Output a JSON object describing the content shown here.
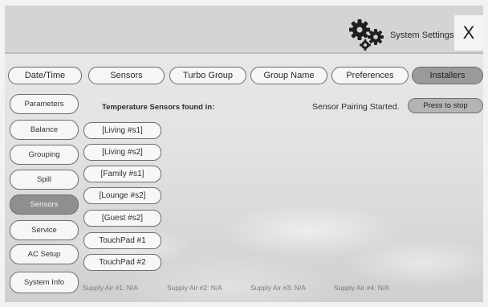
{
  "header": {
    "title": "System Settings",
    "close_label": "X",
    "gear_icon": "gears-icon"
  },
  "tabs": [
    {
      "label": "Date/Time",
      "active": false
    },
    {
      "label": "Sensors",
      "active": false
    },
    {
      "label": "Turbo Group",
      "active": false
    },
    {
      "label": "Group Name",
      "active": false
    },
    {
      "label": "Preferences",
      "active": false
    },
    {
      "label": "Installers",
      "active": true
    }
  ],
  "sidebar": {
    "items": [
      {
        "label": "Parameters",
        "active": false
      },
      {
        "label": "Balance",
        "active": false
      },
      {
        "label": "Grouping",
        "active": false
      },
      {
        "label": "Spill",
        "active": false
      },
      {
        "label": "Sensors",
        "active": true
      },
      {
        "label": "Service",
        "active": false
      },
      {
        "label": "AC Setup",
        "active": false
      },
      {
        "label": "System Info",
        "active": false
      }
    ]
  },
  "main": {
    "heading": "Temperature Sensors found in:",
    "pairing_status": "Sensor Pairing Started.",
    "stop_button": "Press to stop",
    "sensors": [
      "[Living #s1]",
      "[Living #s2]",
      "[Family #s1]",
      "[Lounge #s2]",
      "[Guest #s2]",
      "TouchPad #1",
      "TouchPad #2"
    ],
    "supply_air": [
      "Supply Air #1: N/A",
      "Supply Air #2: N/A",
      "Supply Air #3: N/A",
      "Supply Air #4: N/A"
    ]
  },
  "colors": {
    "active_tab": "#9a9a9a",
    "active_side": "#8f8f8f",
    "topbar": "#d4d4d4"
  }
}
